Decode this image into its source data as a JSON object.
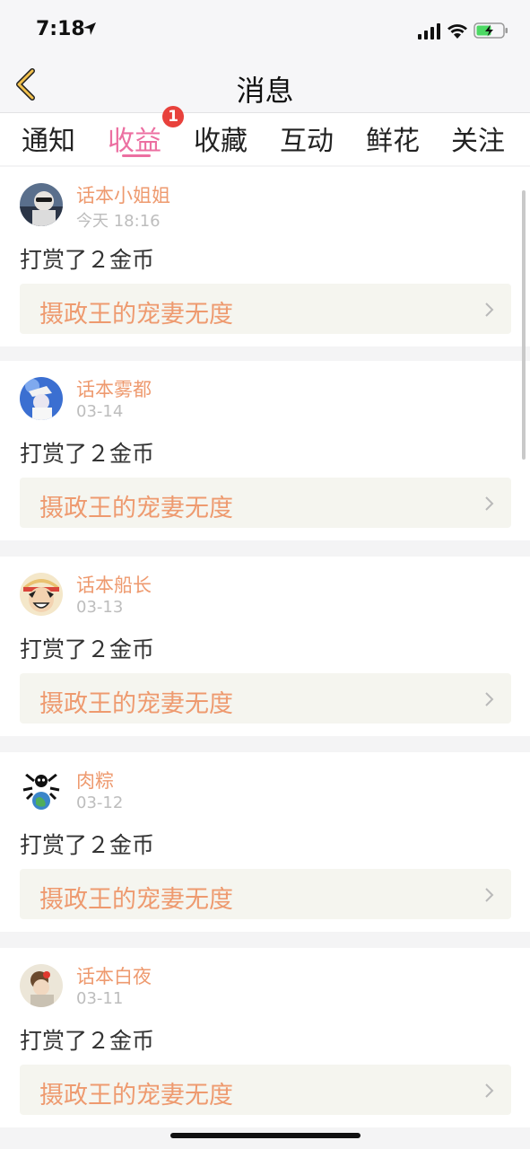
{
  "status_bar": {
    "time": "7:18"
  },
  "nav": {
    "title": "消息"
  },
  "tabs": [
    {
      "label": "通知"
    },
    {
      "label": "收益",
      "badge": "1"
    },
    {
      "label": "收藏"
    },
    {
      "label": "互动"
    },
    {
      "label": "鲜花"
    },
    {
      "label": "关注"
    }
  ],
  "items": [
    {
      "user": "话本小姐姐",
      "time": "今天 18:16",
      "action": "打赏了２金币",
      "book": "摄政王的宠妻无度"
    },
    {
      "user": "话本雾都",
      "time": "03-14",
      "action": "打赏了２金币",
      "book": "摄政王的宠妻无度"
    },
    {
      "user": "话本船长",
      "time": "03-13",
      "action": "打赏了２金币",
      "book": "摄政王的宠妻无度"
    },
    {
      "user": "肉粽",
      "time": "03-12",
      "action": "打赏了２金币",
      "book": "摄政王的宠妻无度"
    },
    {
      "user": "话本白夜",
      "time": "03-11",
      "action": "打赏了２金币",
      "book": "摄政王的宠妻无度"
    }
  ],
  "colors": {
    "accent_pink": "#ec6fa1",
    "accent_orange": "#ee9a6f",
    "badge_red": "#e8413c"
  }
}
